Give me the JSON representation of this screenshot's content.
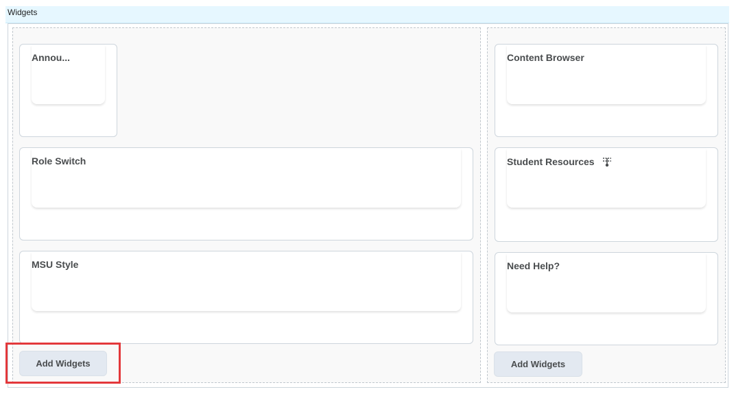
{
  "header": {
    "title": "Widgets"
  },
  "left_column": {
    "widgets": [
      {
        "title": "Annou..."
      },
      {
        "title": "Role Switch"
      },
      {
        "title": "MSU Style"
      }
    ],
    "add_button": "Add Widgets"
  },
  "right_column": {
    "widgets": [
      {
        "title": "Content Browser"
      },
      {
        "title": "Student Resources",
        "icon": "drag-handle-icon"
      },
      {
        "title": "Need Help?"
      }
    ],
    "add_button": "Add Widgets"
  },
  "colors": {
    "header_bg": "#e6f7ff",
    "button_bg": "#e3e9f1",
    "highlight": "#e3383b"
  }
}
